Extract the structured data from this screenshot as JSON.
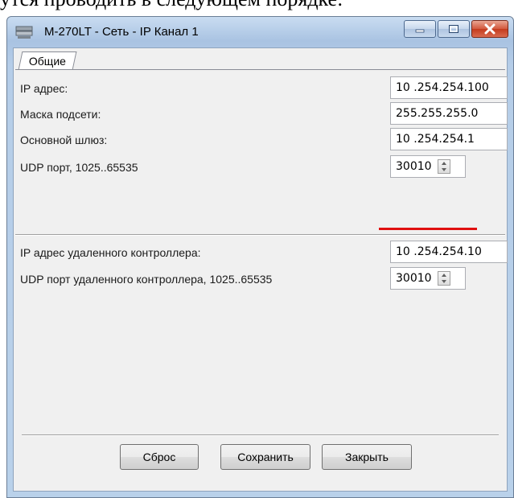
{
  "doc_text": "утся проводить в следующем порядке:",
  "window": {
    "title": "M-270LT - Сеть - IP Канал 1"
  },
  "tabs": [
    {
      "label": "Общие"
    }
  ],
  "fields": {
    "ip_address": {
      "label": "IP адрес:",
      "value": "10 .254.254.100"
    },
    "subnet_mask": {
      "label": "Маска подсети:",
      "value": "255.255.255.0"
    },
    "gateway": {
      "label": "Основной шлюз:",
      "value": "10 .254.254.1"
    },
    "udp_port": {
      "label": "UDP порт, 1025..65535",
      "value": "30010"
    },
    "remote_ip": {
      "label": "IP адрес удаленного контроллера:",
      "value": "10 .254.254.10"
    },
    "remote_udp_port": {
      "label": "UDP порт удаленного контроллера, 1025..65535",
      "value": "30010"
    }
  },
  "buttons": {
    "reset": "Сброс",
    "save": "Сохранить",
    "close": "Закрыть"
  },
  "colors": {
    "annotation_underline": "#e01010",
    "title_bar": "#b9d1ea",
    "close_button": "#c43b1d"
  }
}
